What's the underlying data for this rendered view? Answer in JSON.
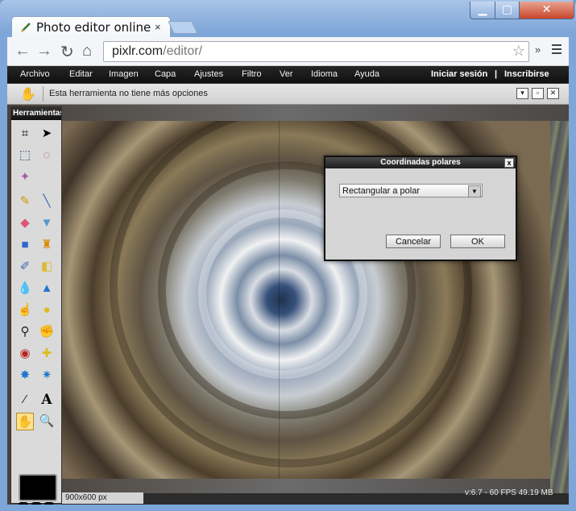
{
  "browser": {
    "tab_title": "Photo editor online",
    "tab_close": "×",
    "url_domain": "pixlr.com",
    "url_path": "/editor/",
    "window_min": "▁",
    "window_max": "▢",
    "window_close": "✕",
    "overflow": "»"
  },
  "menubar": {
    "items": [
      "Archivo",
      "Editar",
      "Imagen",
      "Capa",
      "Ajustes",
      "Filtro",
      "Ver",
      "Idioma",
      "Ayuda"
    ],
    "login": "Iniciar sesión",
    "separator": "|",
    "signup": "Inscribirse"
  },
  "options_bar": {
    "message": "Esta herramienta no tiene más opciones"
  },
  "tools_panel": {
    "title": "Herramientas",
    "active_tool": "hand-tool",
    "text_tool": "A"
  },
  "dialog": {
    "title": "Coordinadas polares",
    "close": "x",
    "mode_value": "Rectangular a polar",
    "cancel_label": "Cancelar",
    "ok_label": "OK"
  },
  "status": {
    "image_size": "900x600 px",
    "perf": "v:6.7 - 60 FPS 49.19 MB"
  },
  "colors": {
    "menubar": "#1a1a1a",
    "active_tool": "#ffe08e",
    "foreground_swatch": "#000000"
  }
}
